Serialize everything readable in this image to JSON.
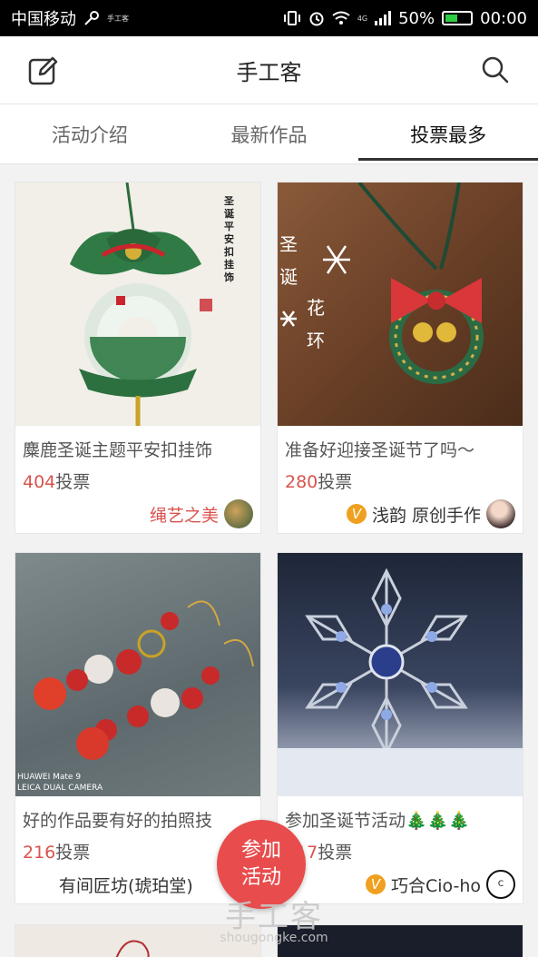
{
  "status_bar": {
    "carrier": "中国移动",
    "carrier_tag": "手工客",
    "network": "4G",
    "battery": "50%",
    "battery_level": 0.5,
    "time": "00:00"
  },
  "header": {
    "title": "手工客",
    "edit_icon": "edit-icon",
    "search_icon": "search-icon"
  },
  "tabs": [
    {
      "label": "活动介绍",
      "active": false
    },
    {
      "label": "最新作品",
      "active": false
    },
    {
      "label": "投票最多",
      "active": true
    }
  ],
  "cards": [
    {
      "title": "麋鹿圣诞主题平安扣挂饰",
      "votes": "404",
      "votes_unit": "投票",
      "author": "绳艺之美",
      "verified": false
    },
    {
      "title": "准备好迎接圣诞节了吗～",
      "votes": "280",
      "votes_unit": "投票",
      "author": "浅韵 原创手作",
      "verified": true
    },
    {
      "title": "好的作品要有好的拍照技",
      "votes": "216",
      "votes_unit": "投票",
      "author": "有间匠坊(琥珀堂)",
      "verified": false
    },
    {
      "title": "参加圣诞节活动🎄🎄🎄",
      "votes": "217",
      "votes_unit": "投票",
      "author": "巧合Cio-ho",
      "verified": true
    }
  ],
  "image_texts": {
    "card1_vertical": "圣诞平安扣挂饰",
    "card2_vertical_a": "圣诞",
    "card2_vertical_b": "花环",
    "card3_camera": "HUAWEI Mate 9",
    "card3_camera2": "LEICA DUAL CAMERA"
  },
  "fab": {
    "line1": "参加",
    "line2": "活动"
  },
  "watermark": {
    "big": "手工客",
    "small": "shougongke.com"
  },
  "colors": {
    "accent": "#e84c4c",
    "vote_number": "#d9534f",
    "verified_badge": "#f0a020"
  }
}
